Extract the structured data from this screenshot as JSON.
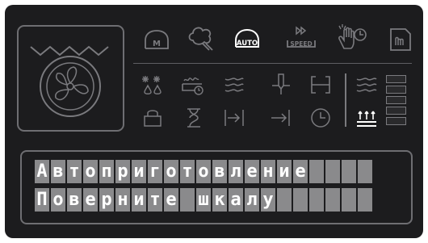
{
  "display": {
    "line1": "Автоприготовление",
    "line2": "Поверните шкалу",
    "line_width": 21
  },
  "mode_icons": [
    {
      "name": "manual-mode-icon",
      "label": "M",
      "active": false
    },
    {
      "name": "steam-clean-icon",
      "label": "",
      "active": false
    },
    {
      "name": "auto-mode-icon",
      "label": "AUTO",
      "active": true
    },
    {
      "name": "speed-mode-icon",
      "label": "SPEED",
      "active": false
    },
    {
      "name": "hand-cleaning-timer-icon",
      "label": "",
      "active": false
    },
    {
      "name": "save-favorite-icon",
      "label": "",
      "active": false
    }
  ],
  "symbol_icons": [
    "defrost-icon",
    "grill-timer-icon",
    "heat-waves-icon",
    "temperature-probe-icon",
    "frame-icon",
    "child-lock-icon",
    "hourglass-icon",
    "end-time-icon",
    "delay-start-icon",
    "clock-icon",
    "humidity-icon",
    "bottom-heat-icon"
  ],
  "level_indicator": {
    "total": 5,
    "filled": 0
  },
  "colors": {
    "panel": "#1c1c1e",
    "icon": "#7a7a7e",
    "active_icon": "#ffffff",
    "cell": "#8a8a8c",
    "text": "#ffffff"
  }
}
